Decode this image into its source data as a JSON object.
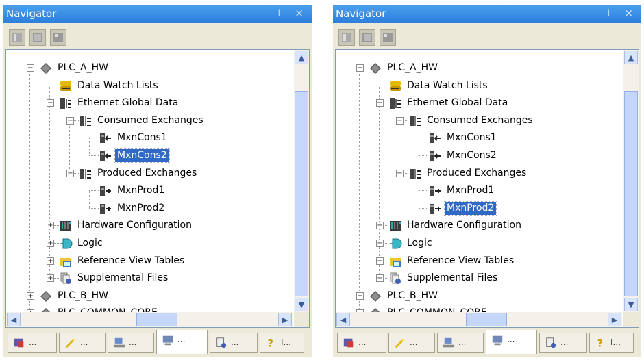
{
  "panels": [
    {
      "id": "left",
      "title": "Navigator",
      "title_icons": "⊥ ×",
      "toolbar_buttons": [
        "properties-icon",
        "grid-icon",
        "layout-icon"
      ],
      "tree": [
        {
          "label": "PLC_A_HW",
          "icon": "plc-diamond-icon",
          "expander": "−",
          "selected": false
        },
        {
          "label": "Data Watch Lists",
          "icon": "data-watch-icon",
          "selected": false
        },
        {
          "label": "Ethernet Global Data",
          "icon": "ethernet-icon",
          "expander": "−",
          "selected": false
        },
        {
          "label": "Consumed Exchanges",
          "icon": "exchanges-icon",
          "expander": "−",
          "selected": false
        },
        {
          "label": "MxnCons1",
          "icon": "consume-icon",
          "selected": false
        },
        {
          "label": "MxnCons2",
          "icon": "consume-icon",
          "selected": true
        },
        {
          "label": "Produced Exchanges",
          "icon": "exchanges-icon",
          "expander": "−",
          "selected": false
        },
        {
          "label": "MxnProd1",
          "icon": "produce-icon",
          "selected": false
        },
        {
          "label": "MxnProd2",
          "icon": "produce-icon",
          "selected": false
        },
        {
          "label": "Hardware Configuration",
          "icon": "hardware-icon",
          "expander": "+",
          "selected": false
        },
        {
          "label": "Logic",
          "icon": "logic-icon",
          "expander": "+",
          "selected": false
        },
        {
          "label": "Reference View Tables",
          "icon": "reference-table-icon",
          "expander": "+",
          "selected": false
        },
        {
          "label": "Supplemental Files",
          "icon": "supplemental-files-icon",
          "expander": "+",
          "selected": false
        },
        {
          "label": "PLC_B_HW",
          "icon": "plc-diamond-icon",
          "expander": "+",
          "selected": false
        },
        {
          "label": "PLC_COMMON_CORE",
          "icon": "plc-diamond-icon",
          "expander": "+",
          "selected": false
        }
      ],
      "tabs": [
        {
          "label": "...",
          "icon": "project-icon"
        },
        {
          "label": "...",
          "icon": "wand-icon"
        },
        {
          "label": "...",
          "icon": "network-icon"
        },
        {
          "label": "...",
          "icon": "navigator-icon",
          "active": true
        },
        {
          "label": "...",
          "icon": "docs-icon"
        },
        {
          "label": "I...",
          "icon": "help-icon"
        }
      ]
    },
    {
      "id": "right",
      "title": "Navigator",
      "title_icons": "⊥ ×",
      "toolbar_buttons": [
        "properties-icon",
        "grid-icon",
        "layout-icon"
      ],
      "tree": [
        {
          "label": "PLC_A_HW",
          "icon": "plc-diamond-icon",
          "expander": "−",
          "selected": false
        },
        {
          "label": "Data Watch Lists",
          "icon": "data-watch-icon",
          "selected": false
        },
        {
          "label": "Ethernet Global Data",
          "icon": "ethernet-icon",
          "expander": "−",
          "selected": false
        },
        {
          "label": "Consumed Exchanges",
          "icon": "exchanges-icon",
          "expander": "−",
          "selected": false
        },
        {
          "label": "MxnCons1",
          "icon": "consume-icon",
          "selected": false
        },
        {
          "label": "MxnCons2",
          "icon": "consume-icon",
          "selected": false
        },
        {
          "label": "Produced Exchanges",
          "icon": "exchanges-icon",
          "expander": "−",
          "selected": false
        },
        {
          "label": "MxnProd1",
          "icon": "produce-icon",
          "selected": false
        },
        {
          "label": "MxnProd2",
          "icon": "produce-icon",
          "selected": true
        },
        {
          "label": "Hardware Configuration",
          "icon": "hardware-icon",
          "expander": "+",
          "selected": false
        },
        {
          "label": "Logic",
          "icon": "logic-icon",
          "expander": "+",
          "selected": false
        },
        {
          "label": "Reference View Tables",
          "icon": "reference-table-icon",
          "expander": "+",
          "selected": false
        },
        {
          "label": "Supplemental Files",
          "icon": "supplemental-files-icon",
          "expander": "+",
          "selected": false
        },
        {
          "label": "PLC_B_HW",
          "icon": "plc-diamond-icon",
          "expander": "+",
          "selected": false
        },
        {
          "label": "PLC_COMMON_CORE",
          "icon": "plc-diamond-icon",
          "expander": "+",
          "selected": false
        }
      ],
      "tabs": [
        {
          "label": "...",
          "icon": "project-icon"
        },
        {
          "label": "...",
          "icon": "wand-icon"
        },
        {
          "label": "...",
          "icon": "network-icon"
        },
        {
          "label": "...",
          "icon": "navigator-icon",
          "active": true
        },
        {
          "label": "...",
          "icon": "docs-icon"
        },
        {
          "label": "I...",
          "icon": "help-icon"
        }
      ]
    }
  ],
  "colors": {
    "selection": "#316ac5",
    "titlebar": "#2d7fdc",
    "frame": "#ece9d8"
  }
}
